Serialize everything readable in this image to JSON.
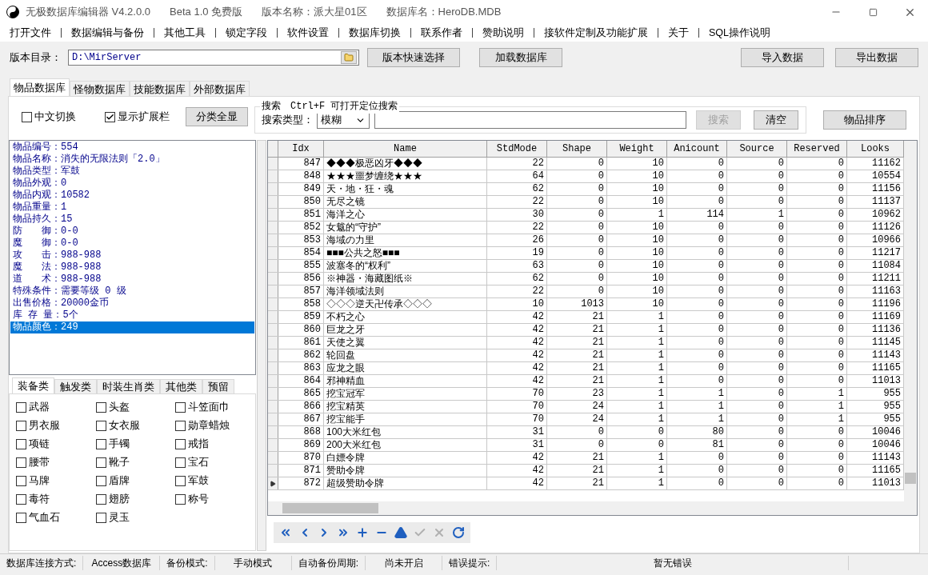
{
  "window": {
    "title": "无极数据库编辑器 V4.2.0.0",
    "edition": "Beta 1.0 免费版",
    "version_label": "版本名称：派大星01区",
    "db_label": "数据库名：HeroDB.MDB"
  },
  "menu": [
    "打开文件",
    "数据编辑与备份",
    "其他工具",
    "锁定字段",
    "软件设置",
    "数据库切换",
    "联系作者",
    "赞助说明",
    "接软件定制及功能扩展",
    "关于",
    "SQL操作说明"
  ],
  "toolbar": {
    "dir_label": "版本目录：",
    "dir_value": "D:\\MirServer",
    "buttons": [
      "版本快速选择",
      "加载数据库"
    ],
    "right_buttons": [
      "导入数据",
      "导出数据"
    ]
  },
  "tabs": [
    {
      "label": "物品数据库",
      "selected": true
    },
    {
      "label": "怪物数据库",
      "selected": false
    },
    {
      "label": "技能数据库",
      "selected": false
    },
    {
      "label": "外部数据库",
      "selected": false
    }
  ],
  "options": [
    {
      "label": "中文切换",
      "checked": false
    },
    {
      "label": "显示扩展栏",
      "checked": true
    }
  ],
  "show_all_button": "分类全显",
  "search": {
    "title": "搜索　Ctrl+F 可打开定位搜索",
    "type_label": "搜索类型：",
    "type_value": "模糊",
    "search_button": "搜索",
    "search_disabled": true,
    "clear_button": "清空"
  },
  "sort_button": "物品排序",
  "info": [
    {
      "text": "物品编号：554",
      "selected": false
    },
    {
      "text": "物品名称：消失的无限法则「2.0」",
      "selected": false
    },
    {
      "text": "物品类型：军鼓",
      "selected": false
    },
    {
      "text": "物品外观：0",
      "selected": false
    },
    {
      "text": "物品内观：10582",
      "selected": false
    },
    {
      "text": "物品重量：1",
      "selected": false
    },
    {
      "text": "物品持久：15",
      "selected": false
    },
    {
      "text": "防　　御：0-0",
      "selected": false
    },
    {
      "text": "魔　　御：0-0",
      "selected": false
    },
    {
      "text": "攻　　击：988-988",
      "selected": false
    },
    {
      "text": "魔　　法：988-988",
      "selected": false
    },
    {
      "text": "道　　术：988-988",
      "selected": false
    },
    {
      "text": "特殊条件：需要等级 0 级",
      "selected": false
    },
    {
      "text": "出售价格：20000金币",
      "selected": false
    },
    {
      "text": "库 存 量：5个",
      "selected": false
    },
    {
      "text": "物品颜色：249",
      "selected": true
    }
  ],
  "category_tabs": [
    {
      "label": "装备类",
      "selected": true
    },
    {
      "label": "触发类",
      "selected": false
    },
    {
      "label": "时装生肖类",
      "selected": false
    },
    {
      "label": "其他类",
      "selected": false
    },
    {
      "label": "预留",
      "selected": false
    }
  ],
  "categories": [
    {
      "label": "武器",
      "checked": false
    },
    {
      "label": "头盔",
      "checked": false
    },
    {
      "label": "斗笠面巾",
      "checked": false
    },
    {
      "label": "男衣服",
      "checked": false
    },
    {
      "label": "女衣服",
      "checked": false
    },
    {
      "label": "勋章蜡烛",
      "checked": false
    },
    {
      "label": "项链",
      "checked": false
    },
    {
      "label": "手镯",
      "checked": false
    },
    {
      "label": "戒指",
      "checked": false
    },
    {
      "label": "腰带",
      "checked": false
    },
    {
      "label": "靴子",
      "checked": false
    },
    {
      "label": "宝石",
      "checked": false
    },
    {
      "label": "马牌",
      "checked": false
    },
    {
      "label": "盾牌",
      "checked": false
    },
    {
      "label": "军鼓",
      "checked": false
    },
    {
      "label": "毒符",
      "checked": false
    },
    {
      "label": "翅膀",
      "checked": false
    },
    {
      "label": "称号",
      "checked": false
    },
    {
      "label": "气血石",
      "checked": false
    },
    {
      "label": "灵玉",
      "checked": false
    }
  ],
  "table": {
    "columns": [
      "Idx",
      "Name",
      "StdMode",
      "Shape",
      "Weight",
      "Anicount",
      "Source",
      "Reserved",
      "Looks"
    ],
    "rows": [
      {
        "cells": [
          "847",
          "◆◆◆极恶凶牙◆◆◆",
          "22",
          "0",
          "10",
          "0",
          "0",
          "0",
          "11162"
        ],
        "current": false
      },
      {
        "cells": [
          "848",
          "★★★噩梦缠绕★★★",
          "64",
          "0",
          "10",
          "0",
          "0",
          "0",
          "10554"
        ],
        "current": false
      },
      {
        "cells": [
          "849",
          "天・地・狂・魂",
          "62",
          "0",
          "10",
          "0",
          "0",
          "0",
          "11156"
        ],
        "current": false
      },
      {
        "cells": [
          "850",
          "无尽之镜",
          "22",
          "0",
          "10",
          "0",
          "0",
          "0",
          "11137"
        ],
        "current": false
      },
      {
        "cells": [
          "851",
          "海洋之心",
          "30",
          "0",
          "1",
          "114",
          "1",
          "0",
          "10962"
        ],
        "current": false
      },
      {
        "cells": [
          "852",
          "女魃的“守护”",
          "22",
          "0",
          "10",
          "0",
          "0",
          "0",
          "11126"
        ],
        "current": false
      },
      {
        "cells": [
          "853",
          "海域の力里",
          "26",
          "0",
          "10",
          "0",
          "0",
          "0",
          "10966"
        ],
        "current": false
      },
      {
        "cells": [
          "854",
          "■■■公共之怒■■■",
          "19",
          "0",
          "10",
          "0",
          "0",
          "0",
          "11217"
        ],
        "current": false
      },
      {
        "cells": [
          "855",
          "波塞冬的“权利”",
          "63",
          "0",
          "10",
          "0",
          "0",
          "0",
          "11084"
        ],
        "current": false
      },
      {
        "cells": [
          "856",
          "※神器・海藏图纸※",
          "62",
          "0",
          "10",
          "0",
          "0",
          "0",
          "11211"
        ],
        "current": false
      },
      {
        "cells": [
          "857",
          "海洋领域法则",
          "22",
          "0",
          "10",
          "0",
          "0",
          "0",
          "11163"
        ],
        "current": false
      },
      {
        "cells": [
          "858",
          "◇◇◇逆天卍传承◇◇◇",
          "10",
          "1013",
          "10",
          "0",
          "0",
          "0",
          "11196"
        ],
        "current": false
      },
      {
        "cells": [
          "859",
          "不朽之心",
          "42",
          "21",
          "1",
          "0",
          "0",
          "0",
          "11169"
        ],
        "current": false
      },
      {
        "cells": [
          "860",
          "巨龙之牙",
          "42",
          "21",
          "1",
          "0",
          "0",
          "0",
          "11136"
        ],
        "current": false
      },
      {
        "cells": [
          "861",
          "天使之翼",
          "42",
          "21",
          "1",
          "0",
          "0",
          "0",
          "11145"
        ],
        "current": false
      },
      {
        "cells": [
          "862",
          "轮回盘",
          "42",
          "21",
          "1",
          "0",
          "0",
          "0",
          "11143"
        ],
        "current": false
      },
      {
        "cells": [
          "863",
          "应龙之眼",
          "42",
          "21",
          "1",
          "0",
          "0",
          "0",
          "11165"
        ],
        "current": false
      },
      {
        "cells": [
          "864",
          "邪神精血",
          "42",
          "21",
          "1",
          "0",
          "0",
          "0",
          "11013"
        ],
        "current": false
      },
      {
        "cells": [
          "865",
          "挖宝冠军",
          "70",
          "23",
          "1",
          "1",
          "0",
          "1",
          "955"
        ],
        "current": false
      },
      {
        "cells": [
          "866",
          "挖宝精英",
          "70",
          "24",
          "1",
          "1",
          "0",
          "1",
          "955"
        ],
        "current": false
      },
      {
        "cells": [
          "867",
          "挖宝能手",
          "70",
          "24",
          "1",
          "1",
          "0",
          "1",
          "955"
        ],
        "current": false
      },
      {
        "cells": [
          "868",
          "100大米红包",
          "31",
          "0",
          "0",
          "80",
          "0",
          "0",
          "10046"
        ],
        "current": false
      },
      {
        "cells": [
          "869",
          "200大米红包",
          "31",
          "0",
          "0",
          "81",
          "0",
          "0",
          "10046"
        ],
        "current": false
      },
      {
        "cells": [
          "870",
          "白嫖令牌",
          "42",
          "21",
          "1",
          "0",
          "0",
          "0",
          "11143"
        ],
        "current": false
      },
      {
        "cells": [
          "871",
          "赞助令牌",
          "42",
          "21",
          "1",
          "0",
          "0",
          "0",
          "11165"
        ],
        "current": false
      },
      {
        "cells": [
          "872",
          "超级赞助令牌",
          "42",
          "21",
          "1",
          "0",
          "0",
          "0",
          "11013"
        ],
        "current": true
      }
    ]
  },
  "navigator": [
    {
      "kind": "first",
      "disabled": false
    },
    {
      "kind": "prior",
      "disabled": false
    },
    {
      "kind": "next",
      "disabled": false
    },
    {
      "kind": "last",
      "disabled": false
    },
    {
      "kind": "insert",
      "disabled": false
    },
    {
      "kind": "delete",
      "disabled": false
    },
    {
      "kind": "edit",
      "disabled": false
    },
    {
      "kind": "post",
      "disabled": true
    },
    {
      "kind": "cancel",
      "disabled": true
    },
    {
      "kind": "refresh",
      "disabled": false
    }
  ],
  "status_bar": [
    {
      "label": "数据库连接方式:",
      "value": "Access数据库"
    },
    {
      "label": "备份模式:",
      "value": "手动模式"
    },
    {
      "label": "自动备份周期:",
      "value": "尚未开启"
    },
    {
      "label": "错误提示:",
      "value": "暂无错误"
    }
  ]
}
